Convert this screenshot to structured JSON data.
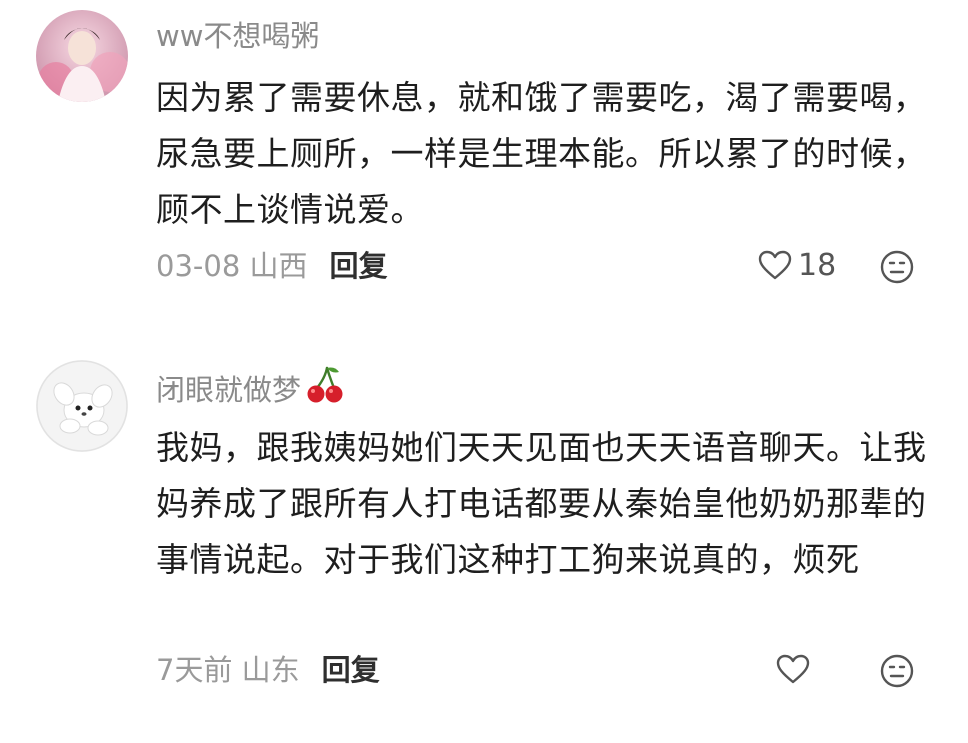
{
  "comments": [
    {
      "username": "ww不想喝粥",
      "text": "因为累了需要休息，就和饿了需要吃，渴了需要喝，尿急要上厕所，一样是生理本能。所以累了的时候，顾不上谈情说爱。",
      "date_location": "03-08 山西",
      "reply_label": "回复",
      "like_count": "18"
    },
    {
      "username": "闭眼就做梦",
      "username_emoji": "cherry-emoji",
      "text": "我妈，跟我姨妈她们天天见面也天天语音聊天。让我妈养成了跟所有人打电话都要从秦始皇他奶奶那辈的事情说起。对于我们这种打工狗来说真的，烦死",
      "date_location": "7天前 山东",
      "reply_label": "回复",
      "like_count": ""
    }
  ],
  "icons": {
    "like": "heart-outline-icon",
    "emoji": "emoji-face-icon"
  },
  "colors": {
    "username": "#8a8a8a",
    "meta": "#9a9a9a",
    "text": "#1e1e1e",
    "icon": "#555555"
  }
}
